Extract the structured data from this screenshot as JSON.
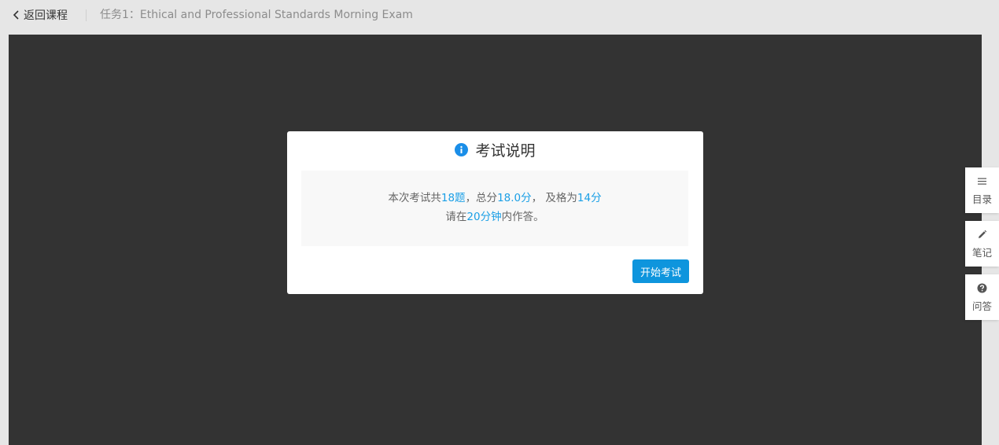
{
  "topbar": {
    "back_label": "返回课程",
    "task_title": "任务1：Ethical and Professional Standards Morning Exam"
  },
  "modal": {
    "title": "考试说明",
    "line1": {
      "prefix": "本次考试共",
      "question_count": "18题",
      "mid1": "，总分",
      "total_score": "18.0分",
      "mid2": "， 及格为",
      "pass_score": "14分"
    },
    "line2": {
      "prefix": "请在",
      "duration": "20分钟",
      "suffix": "内作答。"
    },
    "start_button": "开始考试"
  },
  "side_tabs": [
    {
      "label": "目录",
      "icon": "list-icon"
    },
    {
      "label": "笔记",
      "icon": "pencil-icon"
    },
    {
      "label": "问答",
      "icon": "question-icon"
    }
  ],
  "colors": {
    "accent": "#0e95dd",
    "highlight_text": "#1a9fe6",
    "stage_background": "#333333",
    "page_background": "#e6e6e6"
  }
}
